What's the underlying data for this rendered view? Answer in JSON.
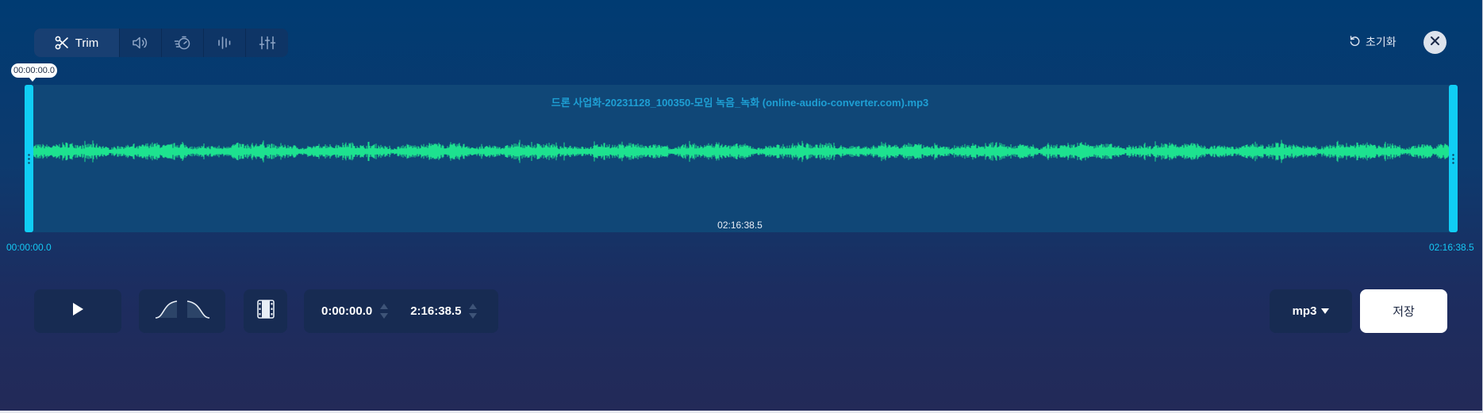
{
  "toolbar": {
    "tools": [
      {
        "id": "trim",
        "label": "Trim",
        "icon": "scissors-icon",
        "active": true
      },
      {
        "id": "volume",
        "icon": "speaker-icon"
      },
      {
        "id": "speed",
        "icon": "speed-icon"
      },
      {
        "id": "equalizer",
        "icon": "waveform-bars-icon"
      },
      {
        "id": "mixer",
        "icon": "sliders-icon"
      }
    ],
    "reset_label": "초기화",
    "reset_icon": "rotate-ccw-icon",
    "close_icon": "close-icon"
  },
  "waveform": {
    "file_name": "드론 사업화-20231128_100350-모임 녹음_녹화 (online-audio-converter.com).mp3",
    "cursor_time": "00:00:00.0",
    "duration_label": "02:16:38.5",
    "start_label": "00:00:00.0",
    "end_label": "02:16:38.5",
    "wave_color": "#1de28f",
    "handle_color": "#10cef5"
  },
  "controls": {
    "play_icon": "play-icon",
    "fade_in_icon": "fade-in-icon",
    "fade_out_icon": "fade-out-icon",
    "loop_icon": "film-loop-icon",
    "start_time": "0:00:00.0",
    "end_time": "2:16:38.5",
    "format": "mp3",
    "save_label": "저장"
  }
}
